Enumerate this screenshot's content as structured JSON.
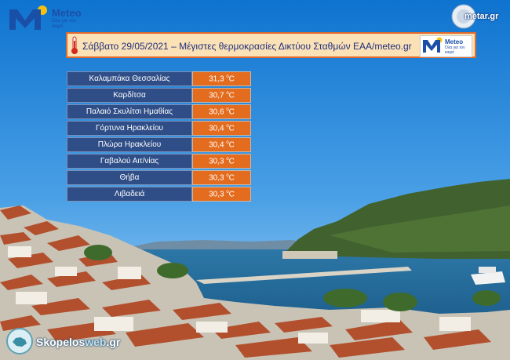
{
  "header": {
    "meteo_logo": {
      "name": "Meteo",
      "tagline": "Όλα για τον καιρό"
    },
    "metar_logo": "metar.gr"
  },
  "title_bar": {
    "title": "Σάββατο 29/05/2021 – Μέγιστες θερμοκρασίες Δικτύου Σταθμών ΕΑΑ/meteo.gr",
    "logo_name": "Meteo",
    "logo_tagline": "Όλα για τον καιρό"
  },
  "stations": [
    {
      "name": "Καλαμπάκα Θεσσαλίας",
      "value": "31,3",
      "unit": "C"
    },
    {
      "name": "Καρδίτσα",
      "value": "30,7",
      "unit": "C"
    },
    {
      "name": "Παλαιό Σκυλίτσι Ημαθίας",
      "value": "30,6",
      "unit": "C"
    },
    {
      "name": "Γόρτυνα Ηρακλείου",
      "value": "30,4",
      "unit": "C"
    },
    {
      "name": "Πλώρα Ηρακλείου",
      "value": "30,4",
      "unit": "C"
    },
    {
      "name": "Γαβαλού Αιτ/νίας",
      "value": "30,3",
      "unit": "C"
    },
    {
      "name": "Θήβα",
      "value": "30,3",
      "unit": "C"
    },
    {
      "name": "Λιβαδειά",
      "value": "30,3",
      "unit": "C"
    }
  ],
  "footer": {
    "brand_main": "Skopelos",
    "brand_web": "web",
    "brand_tld": ".gr"
  },
  "colors": {
    "station_bg": "#2f4e87",
    "temp_bg": "#e46c1f",
    "title_border": "#e26a2b",
    "title_bg": "#fbe1b6"
  }
}
